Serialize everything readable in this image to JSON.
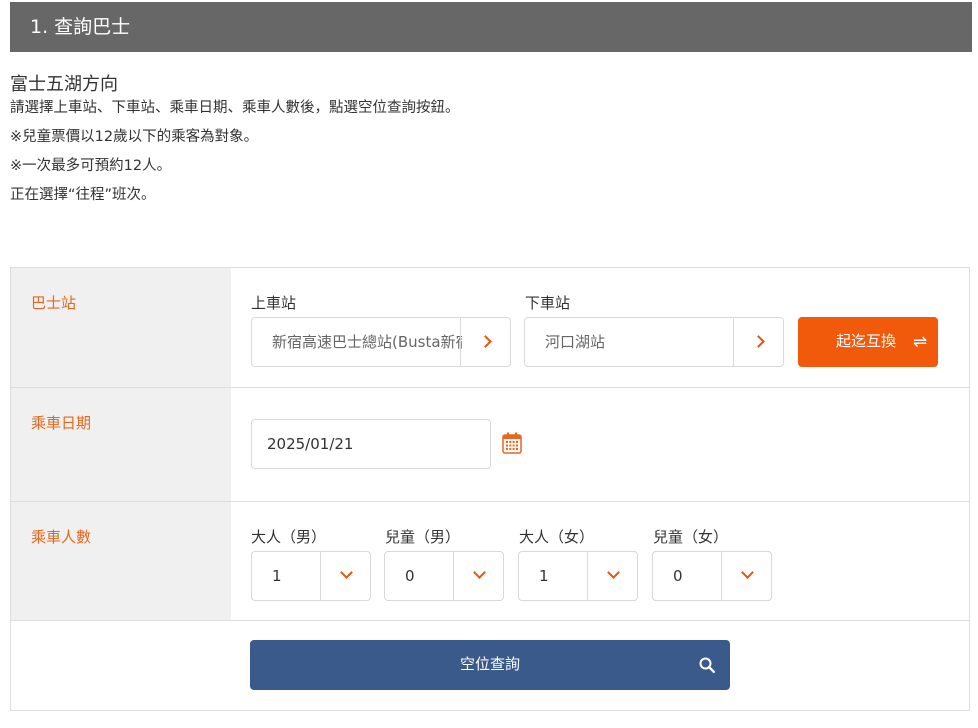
{
  "header": {
    "title": "1. 查詢巴士"
  },
  "intro": {
    "direction": "富士五湖方向",
    "lines": [
      "請選擇上車站、下車站、乘車日期、乘車人數後，點選空位查詢按鈕。",
      "※兒童票價以12歲以下的乘客為對象。",
      "※一次最多可預約12人。",
      "正在選擇“往程”班次。"
    ]
  },
  "form": {
    "station": {
      "label": "巴士站",
      "boarding_label": "上車站",
      "boarding_value": "新宿高速巴士總站(Busta新宿)",
      "alighting_label": "下車站",
      "alighting_value": "河口湖站",
      "swap_label": "起迄互換",
      "swap_icon": "⇌"
    },
    "date": {
      "label": "乘車日期",
      "value": "2025/01/21",
      "icon": "calendar-icon"
    },
    "passengers": {
      "label": "乘車人數",
      "groups": [
        {
          "label": "大人（男）",
          "value": "1"
        },
        {
          "label": "兒童（男）",
          "value": "0"
        },
        {
          "label": "大人（女）",
          "value": "1"
        },
        {
          "label": "兒童（女）",
          "value": "0"
        }
      ]
    },
    "search_label": "空位查詢"
  },
  "colors": {
    "accent": "#e8671d",
    "swap": "#f05a0a",
    "search": "#3a5a8c",
    "header": "#676767"
  }
}
